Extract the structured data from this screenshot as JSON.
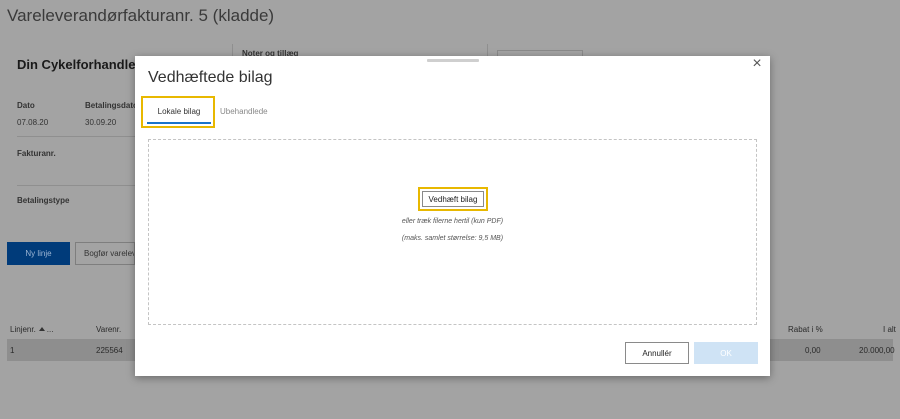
{
  "page": {
    "title": "Vareleverandørfakturanr. 5 (kladde)",
    "vendor_name": "Din Cykelforhandler",
    "notes_label": "Noter og tillæg",
    "date_label": "Dato",
    "date_value": "07.08.20",
    "due_label": "Betalingsdato",
    "due_value": "30.09.20",
    "invoice_no_label": "Fakturanr.",
    "payment_type_label": "Betalingstype",
    "new_line_button": "Ny linje",
    "post_button": "Bogfør varelev"
  },
  "table": {
    "headers": {
      "line_no": "Linjenr.",
      "line_no_more": "...",
      "item_no": "Varenr.",
      "discount": "Rabat i %",
      "total": "I alt"
    },
    "row": {
      "line_no": "1",
      "item_no": "225564",
      "discount": "0,00",
      "total": "20.000,00"
    }
  },
  "modal": {
    "title": "Vedhæftede bilag",
    "tabs": {
      "local": "Lokale bilag",
      "unprocessed": "Ubehandlede"
    },
    "attach_button": "Vedhæft bilag",
    "hint_drag": "eller træk filerne hertil (kun PDF)",
    "hint_size": "(maks. samlet størrelse: 9,5 MB)",
    "cancel_button": "Annullér",
    "ok_button": "OK",
    "close_symbol": "×"
  },
  "colors": {
    "overlay": "#a3a3a3",
    "highlight": "#e8b800",
    "tab_accent": "#1a73c9",
    "primary_button": "#003b7a",
    "ok_disabled": "#cfe3f5"
  }
}
